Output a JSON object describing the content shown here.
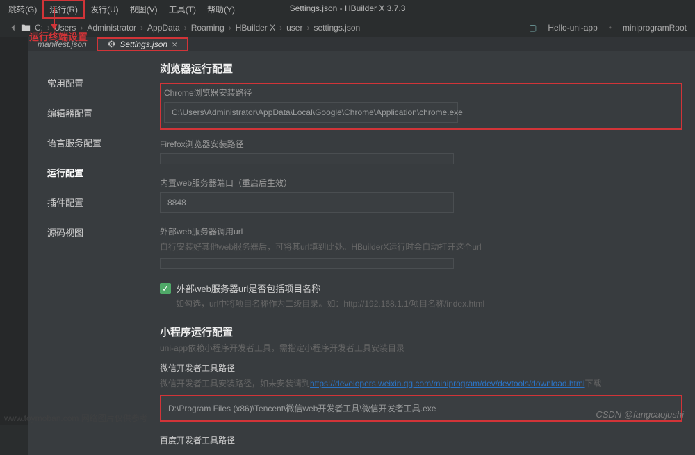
{
  "title": "Settings.json - HBuilder X 3.7.3",
  "menubar": {
    "items": [
      "跳转(G)",
      "运行(R)",
      "发行(U)",
      "视图(V)",
      "工具(T)",
      "帮助(Y)"
    ]
  },
  "pathbar": {
    "segments": [
      "C:",
      "Users",
      "Administrator",
      "AppData",
      "Roaming",
      "HBuilder X",
      "user",
      "settings.json"
    ],
    "right_items": [
      "Hello-uni-app",
      "miniprogramRoot"
    ]
  },
  "red_caption": "运行终端设置",
  "tabs": [
    {
      "label": "manifest.json",
      "active": false
    },
    {
      "label": "Settings.json",
      "active": true
    }
  ],
  "nav": {
    "items": [
      {
        "label": "常用配置",
        "active": false
      },
      {
        "label": "编辑器配置",
        "active": false
      },
      {
        "label": "语言服务配置",
        "active": false
      },
      {
        "label": "运行配置",
        "active": true
      },
      {
        "label": "插件配置",
        "active": false
      },
      {
        "label": "源码视图",
        "active": false
      }
    ]
  },
  "content": {
    "section1_title": "浏览器运行配置",
    "chrome_label": "Chrome浏览器安装路径",
    "chrome_value": "C:\\Users\\Administrator\\AppData\\Local\\Google\\Chrome\\Application\\chrome.exe",
    "firefox_label": "Firefox浏览器安装路径",
    "firefox_value": "",
    "port_label": "内置web服务器端口（重启后生效）",
    "port_value": "8848",
    "ext_url_label": "外部web服务器调用url",
    "ext_url_desc": "自行安装好其他web服务器后，可将其url填到此处。HBuilderX运行时会自动打开这个url",
    "ext_url_value": "",
    "checkbox_label": "外部web服务器url是否包括项目名称",
    "checkbox_desc": "如勾选，url中将项目名称作为二级目录。如：http://192.168.1.1/项目名称/index.html",
    "section2_title": "小程序运行配置",
    "section2_desc": "uni-app依赖小程序开发者工具，需指定小程序开发者工具安装目录",
    "wx_label": "微信开发者工具路径",
    "wx_desc_prefix": "微信开发者工具安装路径，如未安装请到",
    "wx_link": "https://developers.weixin.qq.com/miniprogram/dev/devtools/download.html",
    "wx_desc_suffix": "下载",
    "wx_value": "D:\\Program Files (x86)\\Tencent\\微信web开发者工具\\微信开发者工具.exe",
    "baidu_label": "百度开发者工具路径"
  },
  "watermark": "CSDN @fangcaojushi",
  "watermark_left": "www.toymoban.com  网络图片仅供参考"
}
